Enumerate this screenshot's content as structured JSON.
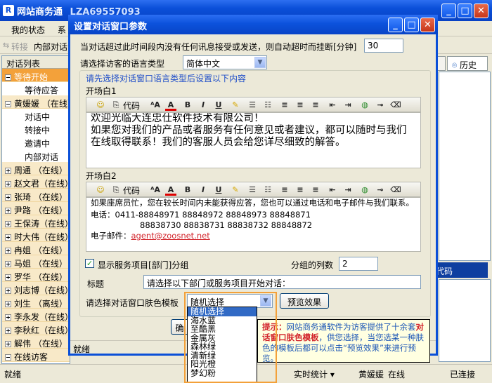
{
  "main_window": {
    "title": "网站商务通",
    "title_id": "LZA69557093",
    "menu": [
      "我的状态",
      "系"
    ],
    "toolbar": {
      "transfer": "转接",
      "internal": "内部对话"
    },
    "status_text": "就绪",
    "status_stats": "实时统计",
    "status_user": "黄媛媛",
    "status_online": "在线",
    "status_conn": "已连接"
  },
  "visitor_list": {
    "header": "对话列表",
    "items": [
      {
        "label": "等待开始",
        "type": "group",
        "expanded": true,
        "selected": true
      },
      {
        "label": "等待应答",
        "type": "sub"
      },
      {
        "label": "黄媛媛 （在线）",
        "type": "group",
        "expanded": true
      },
      {
        "label": "对话中",
        "type": "sub"
      },
      {
        "label": "转接中",
        "type": "sub"
      },
      {
        "label": "邀请中",
        "type": "sub"
      },
      {
        "label": "内部对话",
        "type": "sub"
      },
      {
        "label": "周通 （在线）",
        "type": "group"
      },
      {
        "label": "赵文君（在线）",
        "type": "group"
      },
      {
        "label": "张琦 （在线）",
        "type": "group"
      },
      {
        "label": "尹路 （在线）",
        "type": "group"
      },
      {
        "label": "王保涛（在线）",
        "type": "group"
      },
      {
        "label": "时大伟（在线）",
        "type": "group"
      },
      {
        "label": "冉姐 （在线）",
        "type": "group"
      },
      {
        "label": "马姐 （在线）",
        "type": "group"
      },
      {
        "label": "罗华 （在线）",
        "type": "group"
      },
      {
        "label": "刘志博（在线）",
        "type": "group"
      },
      {
        "label": "刘生 （离线）",
        "type": "group"
      },
      {
        "label": "李永发（在线）",
        "type": "group"
      },
      {
        "label": "李秋红（在线）",
        "type": "group"
      },
      {
        "label": "解伟 （在线）",
        "type": "group"
      },
      {
        "label": "在线访客",
        "type": "group",
        "expanded": true
      }
    ]
  },
  "right_pane": {
    "tab_history": "历史",
    "code_label": "代码"
  },
  "dialog": {
    "title": "设置对话窗口参数",
    "timeout_label": "当对话超过此时间段内没有任何讯息接受或发送，则自动超时而挂断[分钟]",
    "timeout_value": "30",
    "lang_label": "请选择访客的语言类型",
    "lang_value": "简体中文",
    "lang_hint": "请先选择对话窗口语言类型后设置以下内容",
    "opening1_label": "开场白1",
    "opening1_text": "欢迎光临大连忠仕软件技术有限公司！\n如果您对我们的产品或者服务有任何意见或者建议，都可以随时与我们在线取得联系！我们的客服人员会给您详尽细致的解答。",
    "opening2_label": "开场白2",
    "opening2_line1": "如果座席员忙，您在较长时间内未能获得应答，您也可以通过电话和电子邮件与我们联系。",
    "opening2_phone_label": "电话：",
    "opening2_phone1": "0411-88848971 88848972 88848973 88848871",
    "opening2_phone2": "88838730 88838731 88838732 88848872",
    "opening2_email_label": "电子邮件：",
    "opening2_email": "agent@zoosnet.net",
    "toolbar_code": "代码",
    "show_service_label": "显示服务项目[部门]分组",
    "group_cols_label": "分组的列数",
    "group_cols_value": "2",
    "heading_label": "标题",
    "heading_value": "请选择以下部门或服务项目开始对话：",
    "skin_label": "请选择对话窗口肤色模板",
    "skin_value": "随机选择",
    "preview_button": "预览效果",
    "ok_fragment": "确",
    "status": "就绪"
  },
  "skin_options": [
    "随机选择",
    "海水蓝",
    "至酷黑",
    "金属灰",
    "森林绿",
    "清新绿",
    "阳光橙",
    "梦幻粉"
  ],
  "tip": {
    "label": "提示：",
    "pre": "网站商务通软件为访客提供了十余套",
    "bold": "对话窗口肤色模板",
    "post": "，供您选择，当您选某一种肤色的模板后都可以点击“预览效果”来进行预览。"
  },
  "colors": {
    "title_bar": "#0a4fd8",
    "accent_orange": "#f3a13a",
    "link_red": "#d2232a"
  }
}
